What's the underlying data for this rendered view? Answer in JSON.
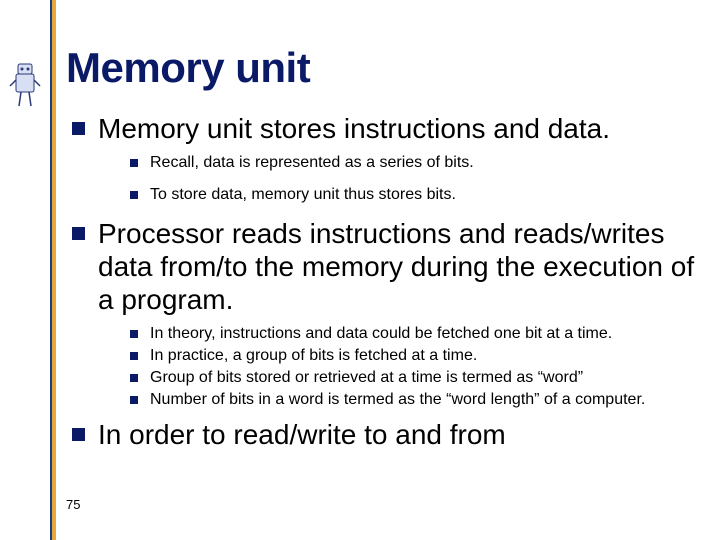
{
  "page_number": "75",
  "title": "Memory unit",
  "bullets": [
    {
      "text": "Memory unit stores instructions and data.",
      "sub": [
        "Recall, data is represented as a series of bits.",
        "To store data, memory unit thus stores bits."
      ]
    },
    {
      "text": "Processor reads instructions and reads/writes data from/to the memory during the execution of a program.",
      "sub": [
        "In theory, instructions and data could be fetched one bit at a time.",
        "In practice, a group of bits is fetched at a time.",
        "Group of bits stored or retrieved at a time is termed as “word”",
        "Number of bits in a word is termed as the “word length” of a computer."
      ]
    },
    {
      "text": "In order to read/write to and from",
      "sub": []
    }
  ]
}
